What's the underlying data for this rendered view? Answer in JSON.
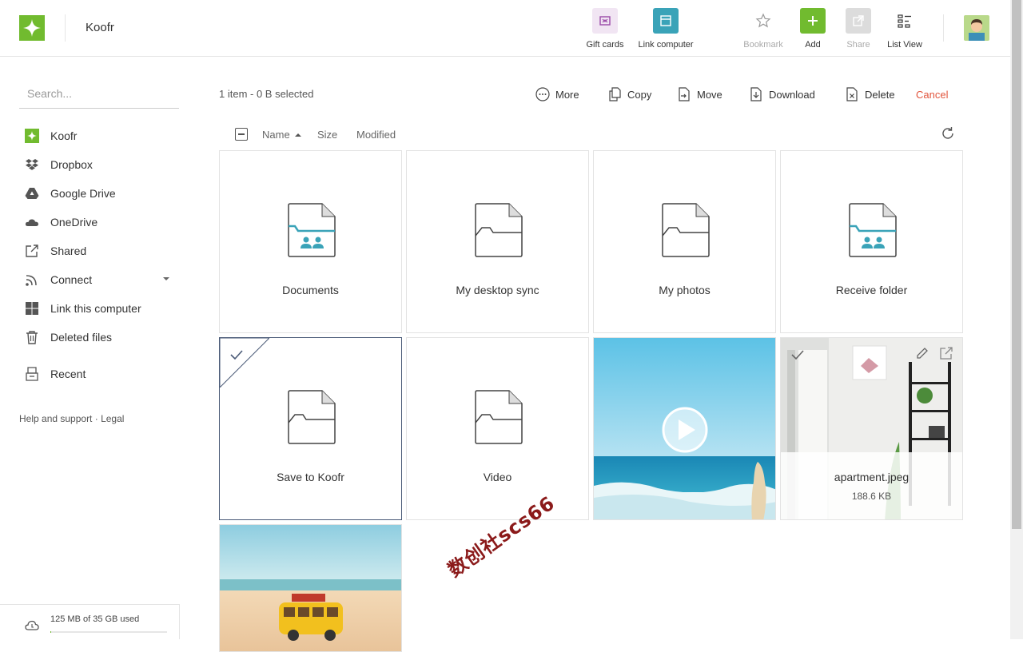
{
  "app": {
    "title": "Koofr"
  },
  "toolbar": {
    "gift_cards": "Gift cards",
    "link_computer": "Link computer",
    "bookmark": "Bookmark",
    "add": "Add",
    "share": "Share",
    "list_view": "List View"
  },
  "sidebar": {
    "search_placeholder": "Search...",
    "items": [
      {
        "label": "Koofr",
        "icon": "koofr-icon"
      },
      {
        "label": "Dropbox",
        "icon": "dropbox-icon"
      },
      {
        "label": "Google Drive",
        "icon": "google-drive-icon"
      },
      {
        "label": "OneDrive",
        "icon": "onedrive-icon"
      },
      {
        "label": "Shared",
        "icon": "shared-icon"
      },
      {
        "label": "Connect",
        "icon": "connect-icon"
      },
      {
        "label": "Link this computer",
        "icon": "windows-icon"
      },
      {
        "label": "Deleted files",
        "icon": "trash-icon"
      },
      {
        "label": "Recent",
        "icon": "recent-icon"
      }
    ],
    "help": "Help and support",
    "separator": " · ",
    "legal": "Legal",
    "storage_text": "125 MB of 35 GB used",
    "storage_fraction": 0.0036
  },
  "selection": {
    "info": "1 item - 0 B selected",
    "actions": {
      "more": "More",
      "copy": "Copy",
      "move": "Move",
      "download": "Download",
      "delete": "Delete",
      "cancel": "Cancel"
    }
  },
  "columns": {
    "name": "Name",
    "size": "Size",
    "modified": "Modified"
  },
  "files": [
    {
      "name": "Documents",
      "type": "shared-folder"
    },
    {
      "name": "My desktop sync",
      "type": "folder"
    },
    {
      "name": "My photos",
      "type": "folder"
    },
    {
      "name": "Receive folder",
      "type": "shared-folder"
    },
    {
      "name": "Save to Koofr",
      "type": "folder",
      "selected": true
    },
    {
      "name": "Video",
      "type": "folder"
    },
    {
      "name": "",
      "type": "video"
    },
    {
      "name": "apartment.jpeg",
      "size": "188.6 KB",
      "type": "image"
    },
    {
      "name": "",
      "type": "image"
    }
  ],
  "colors": {
    "brand_green": "#71bb2f",
    "accent_teal": "#3aa3b8",
    "cancel_red": "#e2553d"
  },
  "watermark": "数创社scs66"
}
